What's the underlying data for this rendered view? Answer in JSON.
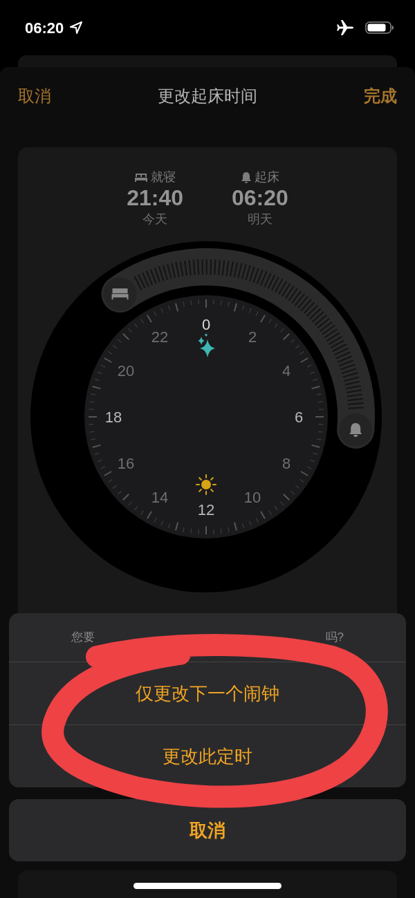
{
  "status_bar": {
    "time": "06:20"
  },
  "header": {
    "cancel": "取消",
    "title": "更改起床时间",
    "done": "完成"
  },
  "schedule": [
    {
      "kind": "bed",
      "label": "就寝",
      "time": "21:40",
      "day": "今天"
    },
    {
      "kind": "wake",
      "label": "起床",
      "time": "06:20",
      "day": "明天"
    }
  ],
  "dial": {
    "hour_labels": [
      "0",
      "2",
      "4",
      "6",
      "8",
      "10",
      "12",
      "14",
      "16",
      "18",
      "20",
      "22"
    ]
  },
  "action_sheet": {
    "message_parts": [
      "您要",
      "吗?"
    ],
    "options": [
      "仅更改下一个闹钟",
      "更改此定时"
    ],
    "cancel": "取消"
  }
}
